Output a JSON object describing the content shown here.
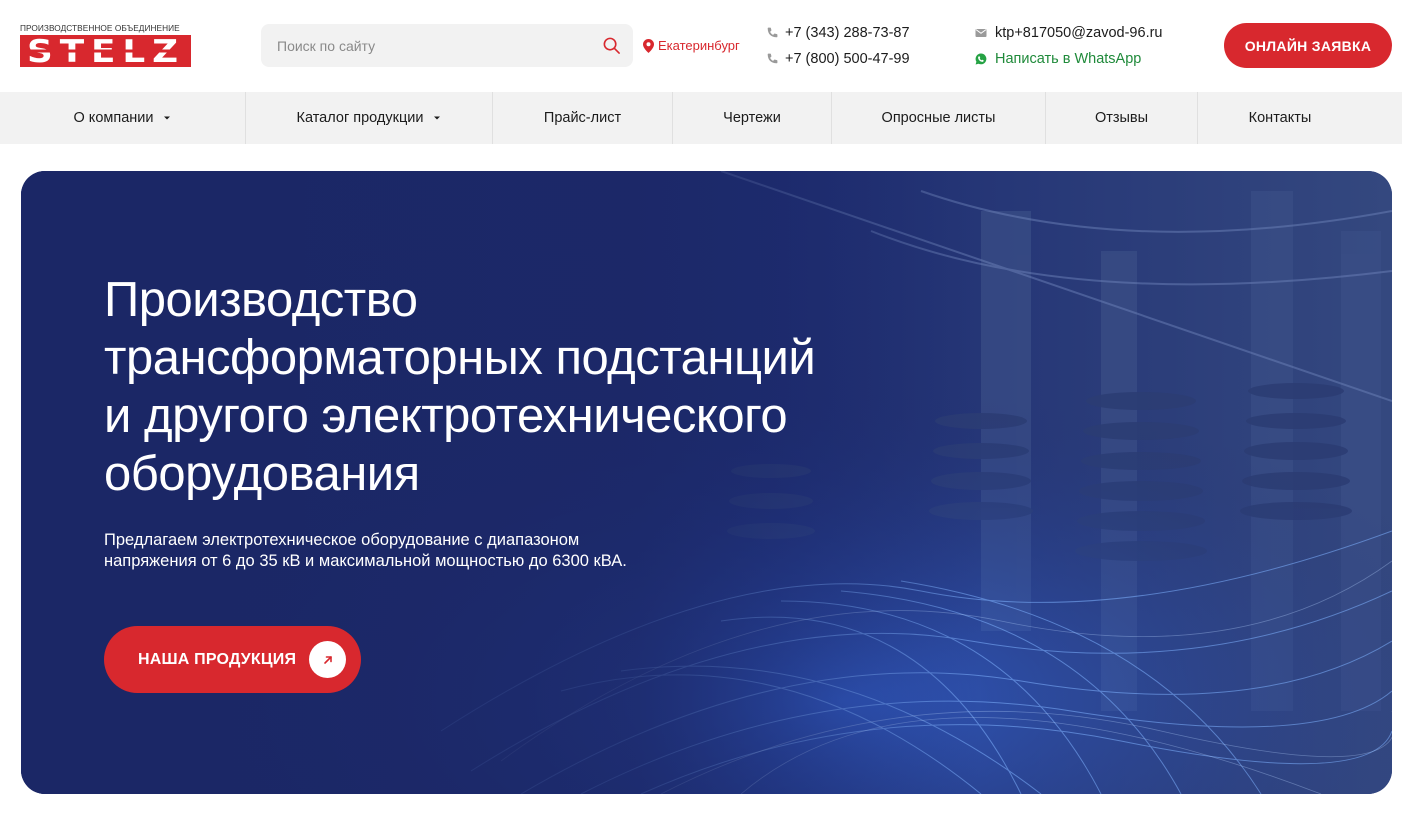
{
  "brand": {
    "caption": "ПРОИЗВОДСТВЕННОЕ ОБЪЕДИНЕНИЕ",
    "name": "STELZ",
    "color": "#d8282e"
  },
  "search": {
    "placeholder": "Поиск по сайту",
    "icon": "search-icon"
  },
  "city": {
    "label": "Екатеринбург",
    "icon": "map-pin-icon"
  },
  "phones": [
    {
      "number": "+7 (343) 288-73-87",
      "icon": "phone-icon"
    },
    {
      "number": "+7 (800) 500-47-99",
      "icon": "phone-icon"
    }
  ],
  "contacts": {
    "email": "ktp+817050@zavod-96.ru",
    "email_icon": "mail-icon",
    "whatsapp": "Написать в WhatsApp",
    "whatsapp_icon": "whatsapp-icon",
    "whatsapp_color": "#1f8a3a"
  },
  "header": {
    "order_button": "ОНЛАЙН ЗАЯВКА"
  },
  "nav": [
    {
      "label": "О компании",
      "dropdown": true
    },
    {
      "label": "Каталог продукции",
      "dropdown": true
    },
    {
      "label": "Прайс-лист",
      "dropdown": false
    },
    {
      "label": "Чертежи",
      "dropdown": false
    },
    {
      "label": "Опросные листы",
      "dropdown": false
    },
    {
      "label": "Отзывы",
      "dropdown": false
    },
    {
      "label": "Контакты",
      "dropdown": false
    }
  ],
  "hero": {
    "title_lines": [
      "Производство",
      "трансформаторных подстанций",
      "и другого электротехнического",
      "оборудования"
    ],
    "subtitle_lines": [
      "Предлагаем электротехническое оборудование с диапазоном",
      "напряжения от 6 до 35 кВ и максимальной мощностью до 6300 кВА."
    ],
    "button": "НАША ПРОДУКЦИЯ",
    "button_icon": "arrow-up-right-icon"
  }
}
